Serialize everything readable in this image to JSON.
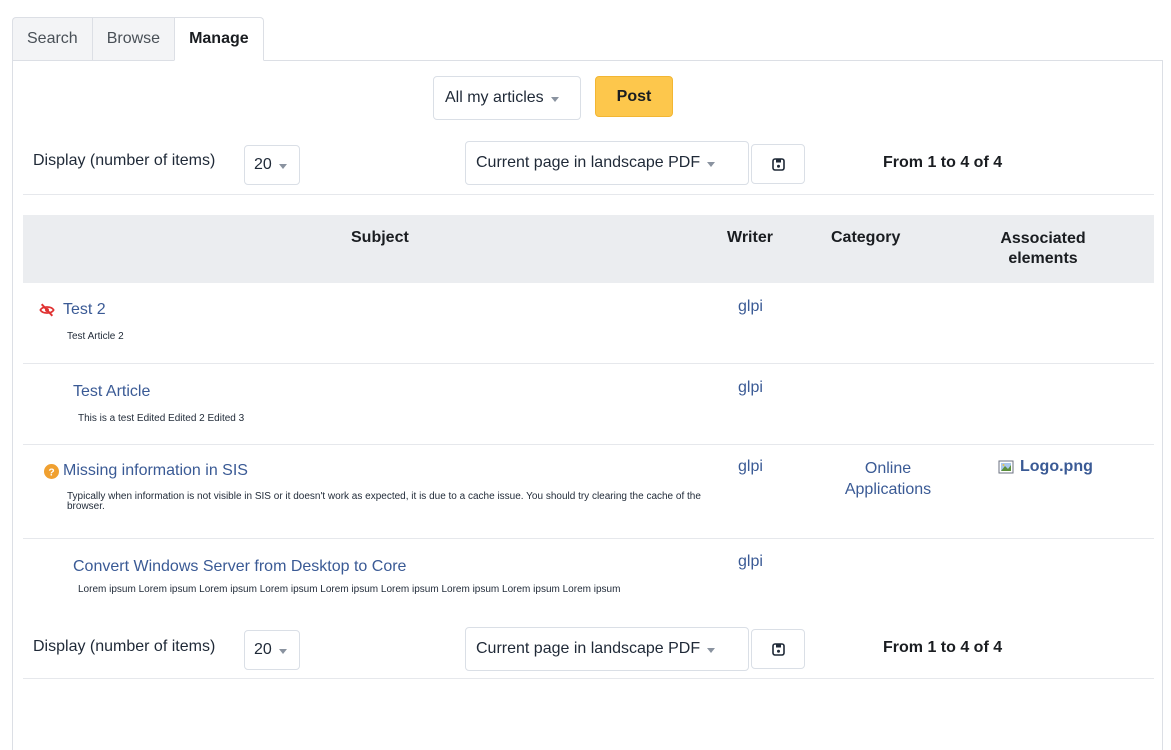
{
  "tabs": [
    {
      "label": "Search",
      "active": false
    },
    {
      "label": "Browse",
      "active": false
    },
    {
      "label": "Manage",
      "active": true
    }
  ],
  "filter": {
    "selected": "All my articles"
  },
  "actions": {
    "post_label": "Post"
  },
  "pager": {
    "display_label": "Display (number of items)",
    "page_size": "20",
    "export_option": "Current page in landscape PDF",
    "info": "From 1 to 4 of 4"
  },
  "table": {
    "headers": {
      "subject": "Subject",
      "writer": "Writer",
      "category": "Category",
      "associated": "Associated elements"
    },
    "rows": [
      {
        "icon": "eye-slash-icon",
        "subject": "Test 2",
        "description": "Test Article 2",
        "writer": "glpi",
        "category": "",
        "associated": ""
      },
      {
        "icon": "",
        "subject": "Test Article",
        "description": "This is a test Edited Edited 2 Edited 3",
        "writer": "glpi",
        "category": "",
        "associated": ""
      },
      {
        "icon": "question-circle-icon",
        "subject": "Missing information in SIS",
        "description": "Typically when information is not visible in SIS or it doesn't work as expected, it is due to a cache issue. You should try clearing the cache of the browser.",
        "writer": "glpi",
        "category": "Online Applications",
        "associated": "Logo.png"
      },
      {
        "icon": "",
        "subject": "Convert Windows Server from Desktop to Core",
        "description": "Lorem ipsum Lorem ipsum Lorem ipsum Lorem ipsum Lorem ipsum Lorem ipsum Lorem ipsum Lorem ipsum Lorem ipsum",
        "writer": "glpi",
        "category": "",
        "associated": ""
      }
    ]
  },
  "colors": {
    "accent": "#fdc74c",
    "link": "#3a5a95",
    "header_bg": "#ebedf0",
    "hidden_icon": "#e03131",
    "help_icon": "#f0a030"
  }
}
